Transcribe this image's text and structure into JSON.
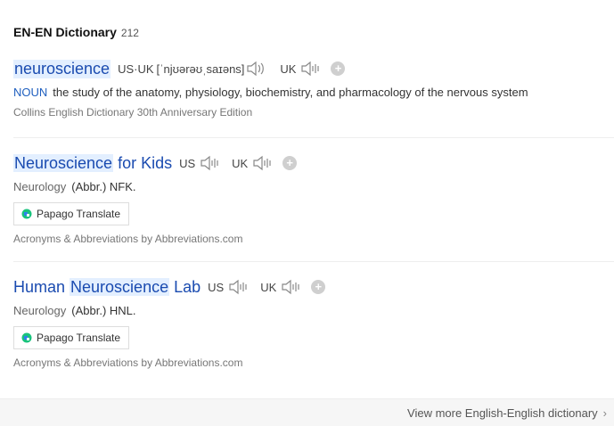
{
  "header": {
    "title": "EN-EN Dictionary",
    "count": "212"
  },
  "entries": [
    {
      "word": "neuroscience",
      "pron": {
        "us_uk_label": "US·UK",
        "ipa": "[ˈnjʊərəʊˌsaɪəns]",
        "uk_label": "UK"
      },
      "pos": "NOUN",
      "definition": "the study of the anatomy, physiology, biochemistry, and pharmacology of the nervous system",
      "source": "Collins English Dictionary 30th Anniversary Edition"
    },
    {
      "word_highlight": "Neuroscience",
      "word_rest": " for Kids",
      "us_label": "US",
      "uk_label": "UK",
      "pos": "Neurology",
      "definition": "(Abbr.) NFK.",
      "translate_label": "Papago Translate",
      "source": "Acronyms & Abbreviations by Abbreviations.com"
    },
    {
      "word_prefix": "Human ",
      "word_highlight": "Neuroscience",
      "word_rest": " Lab",
      "us_label": "US",
      "uk_label": "UK",
      "pos": "Neurology",
      "definition": "(Abbr.) HNL.",
      "translate_label": "Papago Translate",
      "source": "Acronyms & Abbreviations by Abbreviations.com"
    }
  ],
  "footer": {
    "more": "View more English-English dictionary"
  },
  "icons": {
    "speaker": "speaker-icon",
    "add": "plus-icon",
    "papago": "papago-icon",
    "chevron": "chevron-right-icon"
  },
  "colors": {
    "link": "#1a4bb0",
    "highlight": "#e3efff",
    "pos": "#1f5fbf"
  }
}
